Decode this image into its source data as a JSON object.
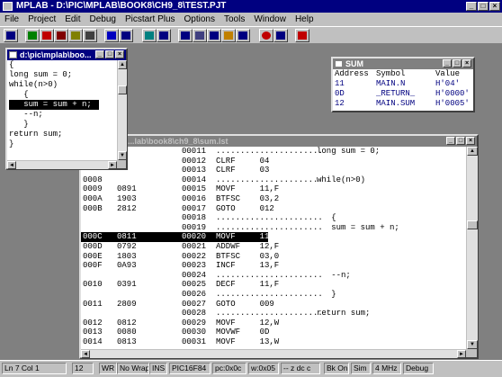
{
  "app": {
    "title": "MPLAB - D:\\PIC\\MPLAB\\BOOK8\\CH9_8\\TEST.PJT"
  },
  "menu": [
    "File",
    "Project",
    "Edit",
    "Debug",
    "Picstart Plus",
    "Options",
    "Tools",
    "Window",
    "Help"
  ],
  "toolbar": {
    "icons": [
      "open-icon",
      "run-icon",
      "halt-icon",
      "step-icon",
      "step-over-icon",
      "reset-icon",
      "watch-icon",
      "trace-icon",
      "breakpoint-icon",
      "stack-icon",
      "memory-icon",
      "registers-icon",
      "symbol-icon",
      "program-icon",
      "chip-icon",
      "options-icon",
      "help-icon"
    ]
  },
  "source_window": {
    "title": "d:\\pic\\mplab\\boo...",
    "lines": [
      "{",
      "long sum = 0;",
      "while(n>0)",
      "   {",
      "   sum = sum + n;",
      "   --n;",
      "   }",
      "return sum;",
      "}"
    ],
    "highlight_index": 4
  },
  "symbol_window": {
    "title": "SUM",
    "headers": {
      "address": "Address",
      "symbol": "Symbol",
      "value": "Value"
    },
    "rows": [
      {
        "address": "11",
        "symbol": "MAIN.N",
        "value": "H'04'"
      },
      {
        "address": "0D",
        "symbol": "_RETURN_",
        "value": "H'0000'"
      },
      {
        "address": "12",
        "symbol": "MAIN.SUM",
        "value": "H'0005'"
      }
    ]
  },
  "listing_window": {
    "title": "...lab\\book8\\ch9_8\\sum.lst",
    "rows": [
      {
        "addr": "",
        "op": "",
        "line": "00011",
        "instr": "......................",
        "src": "long sum = 0;"
      },
      {
        "addr": "",
        "op": "",
        "line": "00012",
        "instr": "CLRF     04",
        "src": ""
      },
      {
        "addr": "",
        "op": "",
        "line": "00013",
        "instr": "CLRF     03",
        "src": ""
      },
      {
        "addr": "0008",
        "op": "",
        "line": "00014",
        "instr": "......................",
        "src": "while(n>0)"
      },
      {
        "addr": "0009",
        "op": "0891",
        "line": "00015",
        "instr": "MOVF     11,F",
        "src": ""
      },
      {
        "addr": "000A",
        "op": "1903",
        "line": "00016",
        "instr": "BTFSC    03,2",
        "src": ""
      },
      {
        "addr": "000B",
        "op": "2812",
        "line": "00017",
        "instr": "GOTO     012",
        "src": ""
      },
      {
        "addr": "",
        "op": "",
        "line": "00018",
        "instr": "......................",
        "src": "   {"
      },
      {
        "addr": "",
        "op": "",
        "line": "00019",
        "instr": "......................",
        "src": "   sum = sum + n;"
      },
      {
        "addr": "000C",
        "op": "0811",
        "line": "00020",
        "instr": "MOVF     11,W",
        "src": ""
      },
      {
        "addr": "000D",
        "op": "0792",
        "line": "00021",
        "instr": "ADDWF    12,F",
        "src": ""
      },
      {
        "addr": "000E",
        "op": "1803",
        "line": "00022",
        "instr": "BTFSC    03,0",
        "src": ""
      },
      {
        "addr": "000F",
        "op": "0A93",
        "line": "00023",
        "instr": "INCF     13,F",
        "src": ""
      },
      {
        "addr": "",
        "op": "",
        "line": "00024",
        "instr": "......................",
        "src": "   --n;"
      },
      {
        "addr": "0010",
        "op": "0391",
        "line": "00025",
        "instr": "DECF     11,F",
        "src": ""
      },
      {
        "addr": "",
        "op": "",
        "line": "00026",
        "instr": "......................",
        "src": "   }"
      },
      {
        "addr": "0011",
        "op": "2809",
        "line": "00027",
        "instr": "GOTO     009",
        "src": ""
      },
      {
        "addr": "",
        "op": "",
        "line": "00028",
        "instr": "......................",
        "src": "return sum;"
      },
      {
        "addr": "0012",
        "op": "0812",
        "line": "00029",
        "instr": "MOVF     12,W",
        "src": ""
      },
      {
        "addr": "0013",
        "op": "0080",
        "line": "00030",
        "instr": "MOVWF    0D",
        "src": ""
      },
      {
        "addr": "0014",
        "op": "0813",
        "line": "00031",
        "instr": "MOVF     13,W",
        "src": ""
      }
    ],
    "highlight_index": 9
  },
  "status": [
    "Ln 7 Col 1",
    "12",
    "WR",
    "No Wrap",
    "INS",
    "PIC16F84",
    "pc:0x0c",
    "w:0x05",
    "-- z dc c",
    "Bk On",
    "Sim",
    "4 MHz",
    "Debug"
  ],
  "colors": {
    "title_active": "#000080",
    "desktop": "#808080",
    "symbol_text": "#000080"
  }
}
